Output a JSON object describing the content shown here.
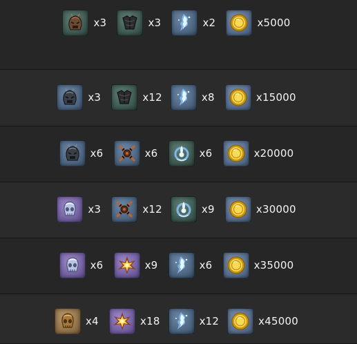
{
  "colors": {
    "tile_green": "#4a6a60",
    "tile_blue": "#566f8e",
    "tile_purple": "#7d6aae",
    "tile_gold": "#9c7c52",
    "coin": "#e8b830",
    "text": "#f4f4f4"
  },
  "rows": [
    {
      "items": [
        {
          "icon": "helmet-icon",
          "rarity": "green",
          "variant": "bronze",
          "qty": "x3"
        },
        {
          "icon": "armor-icon",
          "rarity": "green",
          "variant": "dark",
          "qty": "x3"
        },
        {
          "icon": "spirit-crystal-icon",
          "rarity": "blue",
          "variant": "ice",
          "qty": "x2"
        },
        {
          "icon": "gold-coin-icon",
          "rarity": "coin",
          "variant": "coin",
          "qty": "x5000"
        }
      ]
    },
    {
      "items": [
        {
          "icon": "helmet-icon",
          "rarity": "blue",
          "variant": "steel",
          "qty": "x3"
        },
        {
          "icon": "armor-icon",
          "rarity": "green",
          "variant": "dark",
          "qty": "x12"
        },
        {
          "icon": "spirit-crystal-icon",
          "rarity": "blue",
          "variant": "ice",
          "qty": "x8"
        },
        {
          "icon": "gold-coin-icon",
          "rarity": "coin",
          "variant": "coin",
          "qty": "x15000"
        }
      ]
    },
    {
      "items": [
        {
          "icon": "helmet-icon",
          "rarity": "blue",
          "variant": "steel",
          "qty": "x6"
        },
        {
          "icon": "crossed-blades-icon",
          "rarity": "blue",
          "variant": "rust",
          "qty": "x6"
        },
        {
          "icon": "spirit-orb-icon",
          "rarity": "green",
          "variant": "ice",
          "qty": "x6"
        },
        {
          "icon": "gold-coin-icon",
          "rarity": "coin",
          "variant": "coin",
          "qty": "x20000"
        }
      ]
    },
    {
      "items": [
        {
          "icon": "skull-helmet-icon",
          "rarity": "purple",
          "variant": "pale",
          "qty": "x3"
        },
        {
          "icon": "crossed-blades-icon",
          "rarity": "blue",
          "variant": "rust",
          "qty": "x12"
        },
        {
          "icon": "spirit-orb-icon",
          "rarity": "green",
          "variant": "ice",
          "qty": "x9"
        },
        {
          "icon": "gold-coin-icon",
          "rarity": "coin",
          "variant": "coin",
          "qty": "x30000"
        }
      ]
    },
    {
      "items": [
        {
          "icon": "skull-helmet-icon",
          "rarity": "purple",
          "variant": "pale",
          "qty": "x6"
        },
        {
          "icon": "burst-icon",
          "rarity": "purple",
          "variant": "fire",
          "qty": "x9"
        },
        {
          "icon": "spirit-crystal-icon",
          "rarity": "blue",
          "variant": "ice",
          "qty": "x6"
        },
        {
          "icon": "gold-coin-icon",
          "rarity": "coin",
          "variant": "coin",
          "qty": "x35000"
        }
      ]
    },
    {
      "items": [
        {
          "icon": "skull-helmet-icon",
          "rarity": "gold",
          "variant": "gold",
          "qty": "x4"
        },
        {
          "icon": "burst-icon",
          "rarity": "purple",
          "variant": "fire",
          "qty": "x18"
        },
        {
          "icon": "spirit-crystal-icon",
          "rarity": "blue",
          "variant": "ice",
          "qty": "x12"
        },
        {
          "icon": "gold-coin-icon",
          "rarity": "coin",
          "variant": "coin",
          "qty": "x45000"
        }
      ]
    }
  ]
}
